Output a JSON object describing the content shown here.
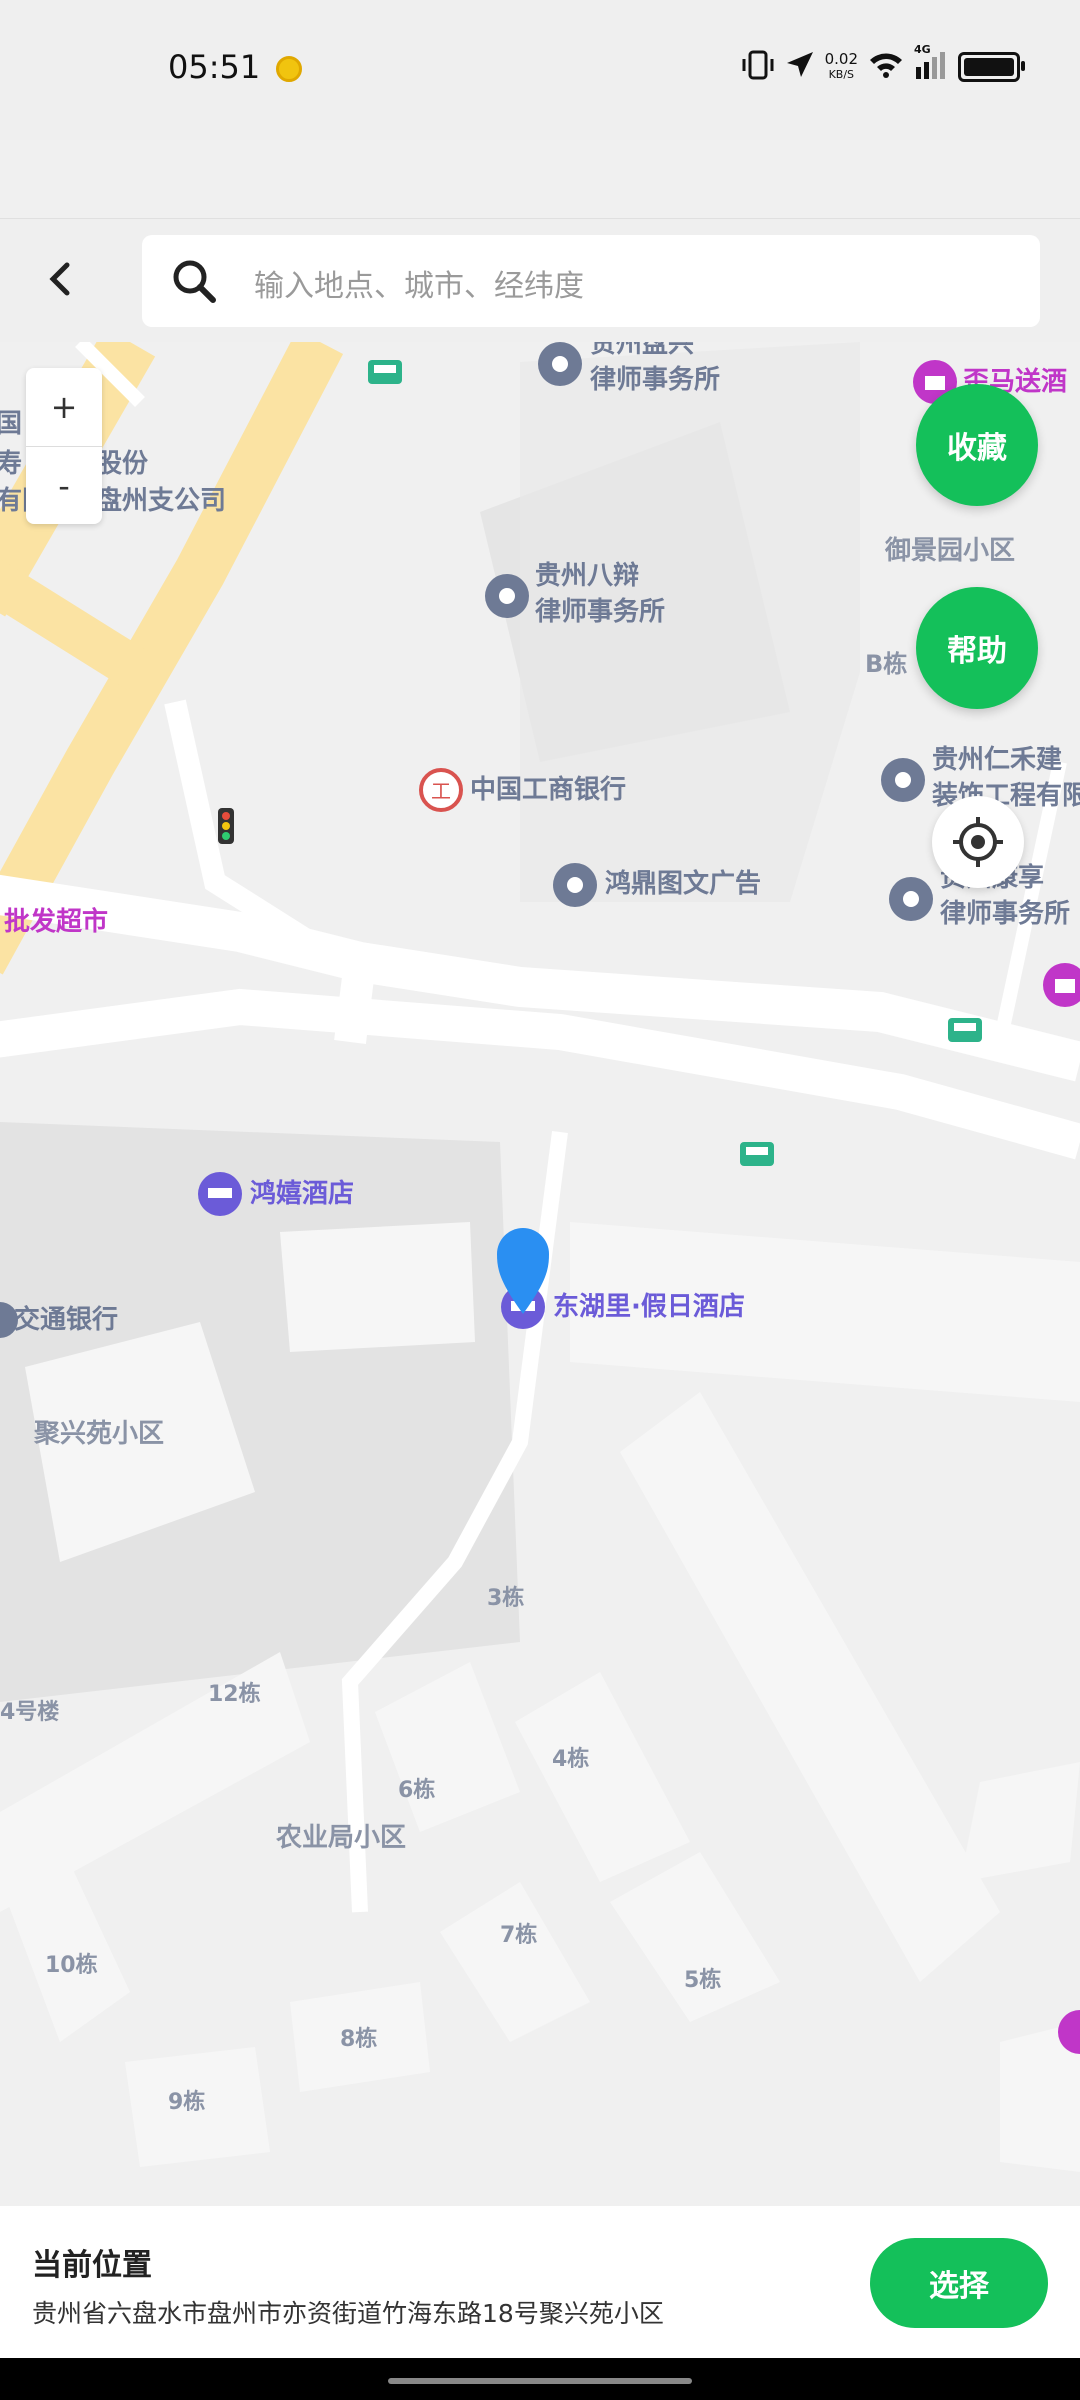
{
  "status_bar": {
    "time": "05:51",
    "net_speed_value": "0.02",
    "net_speed_unit": "KB/S",
    "network_type": "4G",
    "icons": [
      "coin-icon",
      "vibrate-icon",
      "location-arrow-icon",
      "wifi-icon",
      "signal-icon",
      "battery-icon"
    ]
  },
  "search": {
    "placeholder": "输入地点、城市、经纬度",
    "back_icon": "chevron-left-icon",
    "search_icon": "search-icon"
  },
  "map": {
    "zoom_in": "+",
    "zoom_out": "-",
    "favorite_label": "收藏",
    "help_label": "帮助",
    "locate_icon": "locate-icon",
    "labels": {
      "law_firm_pan_l1": "贵州盘兴",
      "law_firm_pan_l2": "律师事务所",
      "courier_top": "歪马送酒",
      "company_l1": "国",
      "company_l2": "寿",
      "company_l2b": "股份",
      "company_l3": "有限",
      "company_l3b": "盘州支公司",
      "yujing": "御景园小区",
      "bajian_l1": "贵州八辩",
      "bajian_l2": "律师事务所",
      "b_building": "B栋",
      "icbc": "中国工商银行",
      "renhe_l1": "贵州仁禾建",
      "renhe_l2": "装饰工程有限",
      "hongding": "鸿鼎图文广告",
      "kangxiang_l1": "贵州康享",
      "kangxiang_l2": "律师事务所",
      "supermarket": "批发超市",
      "hongxi_hotel": "鸿嬉酒店",
      "dhl_hotel": "东湖里·假日酒店",
      "bocom": "交通银行",
      "juxingyuan": "聚兴苑小区",
      "b3": "3栋",
      "b4lou": "4号楼",
      "b12": "12栋",
      "b6": "6栋",
      "b4": "4栋",
      "nongyeju": "农业局小区",
      "b10": "10栋",
      "b7": "7栋",
      "b5": "5栋",
      "b8": "8栋",
      "b9": "9栋"
    }
  },
  "bottom": {
    "current_title": "当前位置",
    "current_address": "贵州省六盘水市盘州市亦资街道竹海东路18号聚兴苑小区",
    "choose_label": "选择"
  },
  "colors": {
    "accent": "#14c05a",
    "poi_gray": "#6e7a95",
    "poi_purple": "#6b5bd8",
    "poi_magenta": "#c036c8",
    "main_road": "#fbe3a3",
    "pin": "#2a8ff2"
  }
}
